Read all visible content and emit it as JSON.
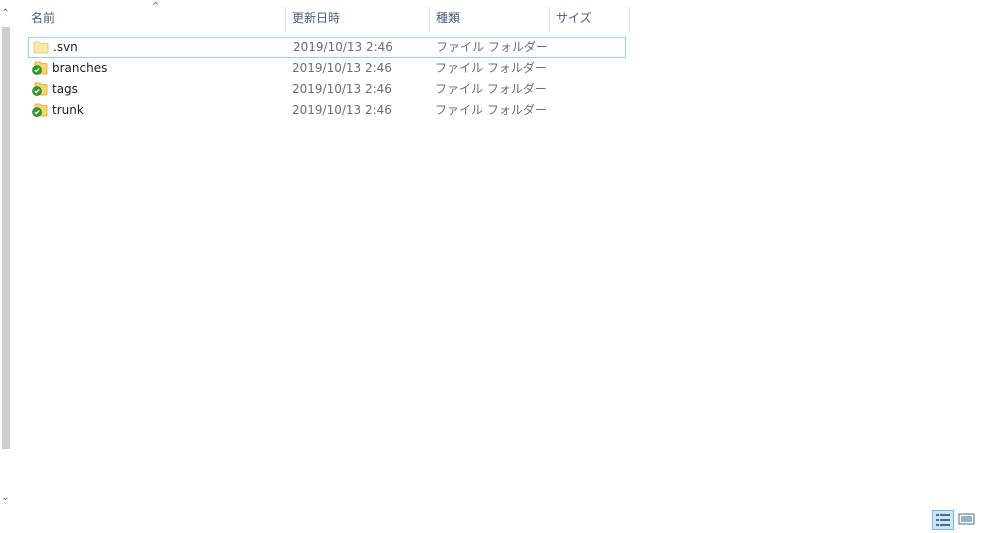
{
  "columns": {
    "name": "名前",
    "date": "更新日時",
    "type": "種類",
    "size": "サイズ"
  },
  "files": [
    {
      "name": ".svn",
      "date": "2019/10/13 2:46",
      "type": "ファイル フォルダー",
      "size": "",
      "icon": "plain-folder-icon"
    },
    {
      "name": "branches",
      "date": "2019/10/13 2:46",
      "type": "ファイル フォルダー",
      "size": "",
      "icon": "svn-normal-folder-icon"
    },
    {
      "name": "tags",
      "date": "2019/10/13 2:46",
      "type": "ファイル フォルダー",
      "size": "",
      "icon": "svn-normal-folder-icon"
    },
    {
      "name": "trunk",
      "date": "2019/10/13 2:46",
      "type": "ファイル フォルダー",
      "size": "",
      "icon": "svn-normal-folder-icon"
    }
  ],
  "view_buttons": {
    "details_icon": "details-view-icon",
    "tiles_icon": "large-icons-view-icon"
  },
  "colors": {
    "header_text": "#4c607a",
    "focus_border": "#99d1e4",
    "svn_ok_badge": "#2d9b2d",
    "folder": "#f5d66f"
  }
}
